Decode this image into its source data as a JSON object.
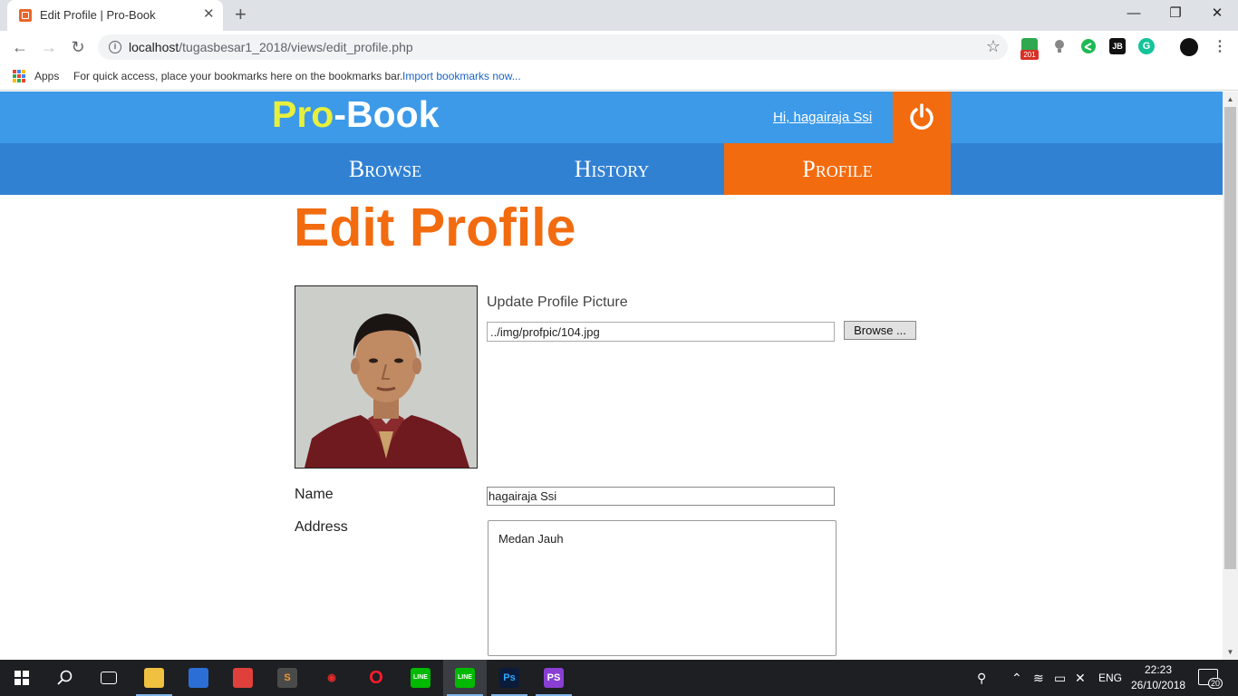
{
  "browser": {
    "tab_title": "Edit Profile | Pro-Book",
    "url_host": "localhost",
    "url_path": "/tugasbesar1_2018/views/edit_profile.php",
    "extension_badge": "201"
  },
  "bookmarks": {
    "apps_label": "Apps",
    "hint": "For quick access, place your bookmarks here on the bookmarks bar.",
    "import_link": "Import bookmarks now..."
  },
  "header": {
    "logo_pro": "Pro",
    "logo_book": "-Book",
    "greeting": "Hi, hagairaja Ssi",
    "colors": {
      "header_bg": "#3c9ae8",
      "nav_bg": "#3181d3",
      "accent": "#f26b0f",
      "logo_pro": "#e7f03c"
    }
  },
  "nav": {
    "items": [
      {
        "label": "Browse",
        "active": false
      },
      {
        "label": "History",
        "active": false
      },
      {
        "label": "Profile",
        "active": true
      }
    ]
  },
  "page": {
    "title": "Edit Profile",
    "upload_label": "Update Profile Picture",
    "picture_path": "../img/profpic/104.jpg",
    "browse_label": "Browse ...",
    "name_label": "Name",
    "name_value": "hagairaja Ssi",
    "address_label": "Address",
    "address_value": "Medan Jauh"
  },
  "taskbar": {
    "language": "ENG",
    "time": "22:23",
    "date": "26/10/2018",
    "notification_count": "20"
  }
}
